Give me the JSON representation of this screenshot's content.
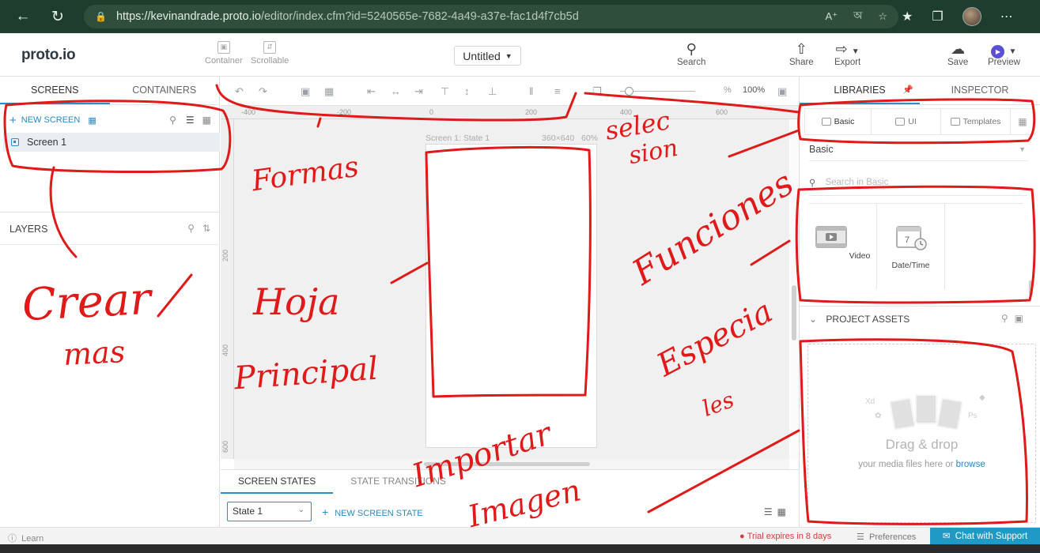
{
  "browser": {
    "url_host": "https://kevinandrade.proto.io",
    "url_path": "/editor/index.cfm?id=5240565e-7682-4a49-a37e-fac1d4f7cb5d",
    "back_icon": "arrow-left-icon",
    "reload_icon": "reload-icon"
  },
  "app": {
    "logo": "proto.io",
    "container_label": "Container",
    "scrollable_label": "Scrollable",
    "project_title": "Untitled",
    "search_label": "Search",
    "share_label": "Share",
    "export_label": "Export",
    "save_label": "Save",
    "preview_label": "Preview"
  },
  "left_panel": {
    "tabs": [
      "SCREENS",
      "CONTAINERS"
    ],
    "new_screen_label": "NEW SCREEN",
    "screens": [
      "Screen 1"
    ],
    "layers_label": "LAYERS"
  },
  "canvas": {
    "zoom_pct_symbol": "%",
    "zoom_value": "100%",
    "ruler_top": [
      "-400",
      "-200",
      "0",
      "200",
      "400",
      "600"
    ],
    "ruler_left": [
      "200",
      "400",
      "600"
    ],
    "screen_name": "Screen 1: State 1",
    "screen_size": "360×640",
    "screen_zoom": "60%"
  },
  "states_panel": {
    "tabs": [
      "SCREEN STATES",
      "STATE TRANSITIONS"
    ],
    "state_value": "State 1",
    "new_state_label": "NEW SCREEN STATE"
  },
  "right_panel": {
    "tabs": [
      "LIBRARIES",
      "INSPECTOR"
    ],
    "lib_tabs": [
      "Basic",
      "UI",
      "Templates"
    ],
    "library_select": "Basic",
    "search_placeholder": "Search in Basic",
    "items": [
      "Video",
      "Date/Time"
    ],
    "date_number": "7",
    "project_assets_label": "PROJECT ASSETS",
    "drag_title": "Drag & drop",
    "drag_sub_prefix": "your media files here or",
    "browse_label": "browse",
    "xd_label": "Xd",
    "ps_label": "Ps"
  },
  "footer": {
    "learn_label": "Learn",
    "trial_label": "Trial expires in 8 days",
    "preferences_label": "Preferences",
    "chat_label": "Chat with Support"
  },
  "annotations": {
    "color": "#e01919",
    "formas": "Formas",
    "seleccion_1": "selec",
    "seleccion_2": "sion",
    "crear": "Crear",
    "mas": "mas",
    "hoja": "Hoja",
    "principal": "Principal",
    "funciones": "Funciones",
    "especia": "Especia",
    "les": "les",
    "importar": "Importar",
    "imagen": "Imagen"
  }
}
